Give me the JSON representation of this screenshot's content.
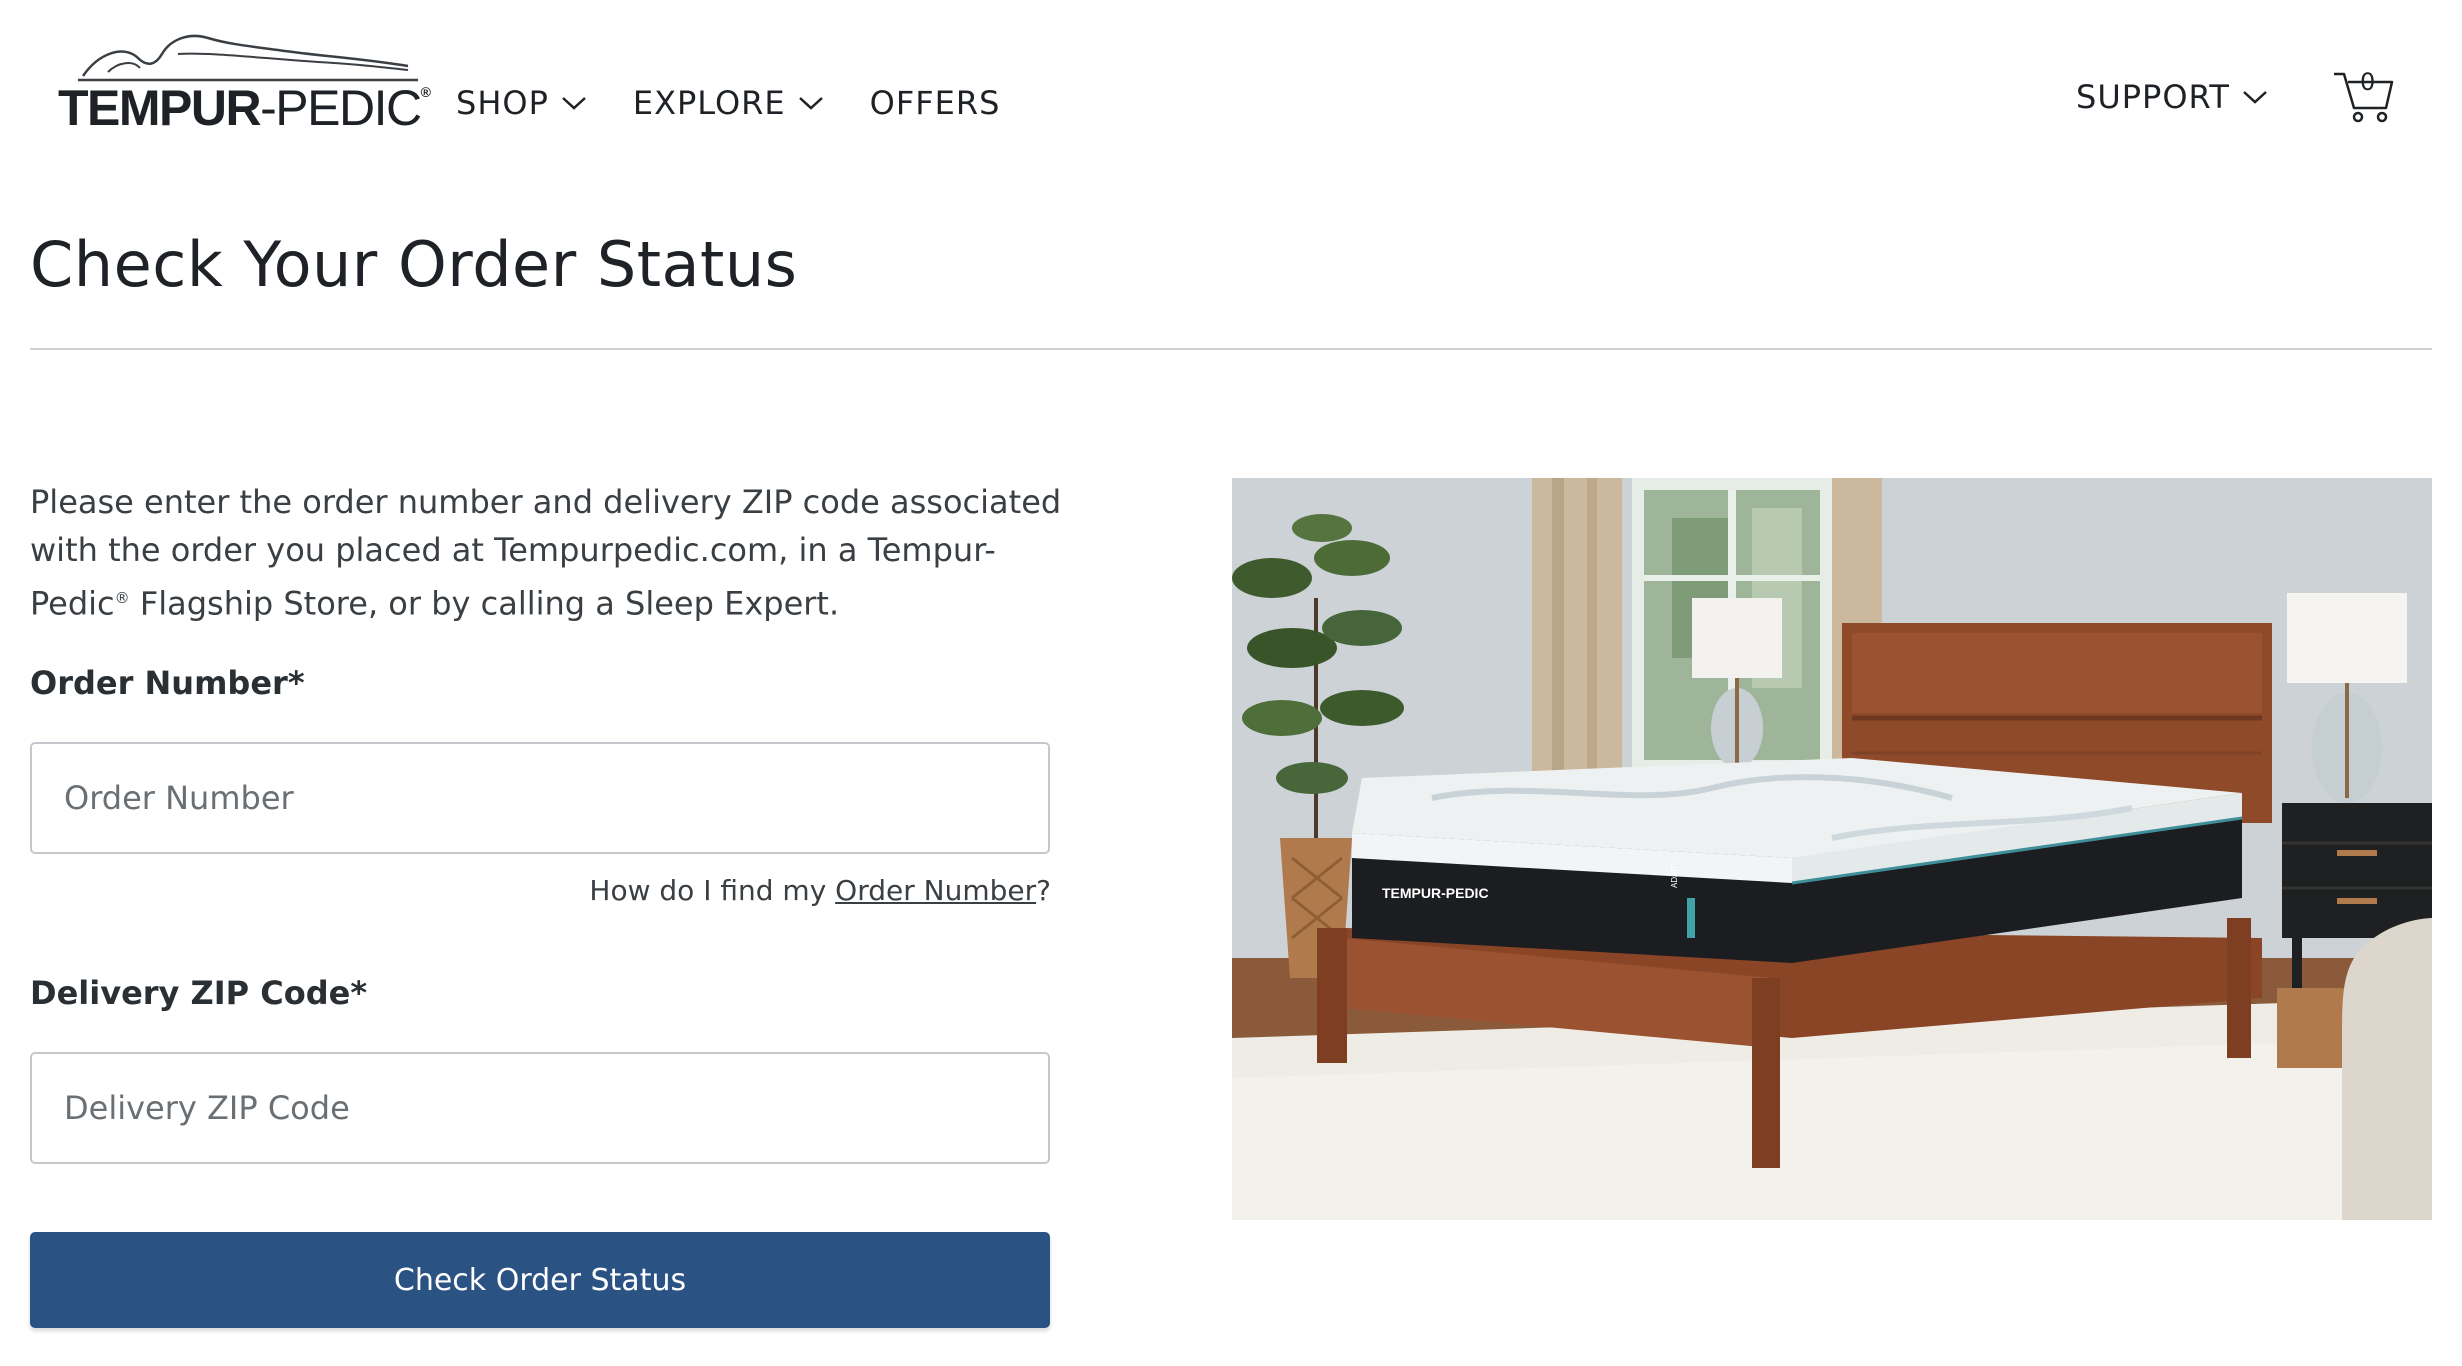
{
  "brand": {
    "name_bold": "TEMPUR",
    "name_thin": "-PEDIC",
    "registered": "®"
  },
  "nav": {
    "items": [
      {
        "label": "SHOP",
        "has_dropdown": true
      },
      {
        "label": "EXPLORE",
        "has_dropdown": true
      },
      {
        "label": "OFFERS",
        "has_dropdown": false
      }
    ],
    "support_label": "SUPPORT",
    "cart_count": "0"
  },
  "page": {
    "title": "Check Your Order Status",
    "intro_part1": "Please enter the order number and delivery ZIP code associated with the order you placed at Tempurpedic.com, in a Tempur-Pedic",
    "intro_reg": "®",
    "intro_part2": " Flagship Store, or by calling a Sleep Expert."
  },
  "form": {
    "order_number_label": "Order Number*",
    "order_number_placeholder": "Order Number",
    "order_number_value": "",
    "help_prefix": "How do I find my ",
    "help_link": "Order Number",
    "help_suffix": "?",
    "zip_label": "Delivery ZIP Code*",
    "zip_placeholder": "Delivery ZIP Code",
    "zip_value": "",
    "submit_label": "Check Order Status"
  },
  "image": {
    "mattress_brand": "TEMPUR-PEDIC",
    "mattress_model": "ADAPT"
  },
  "colors": {
    "primary_button": "#2a5283",
    "text": "#1e2226",
    "divider": "#cfd2d4"
  }
}
